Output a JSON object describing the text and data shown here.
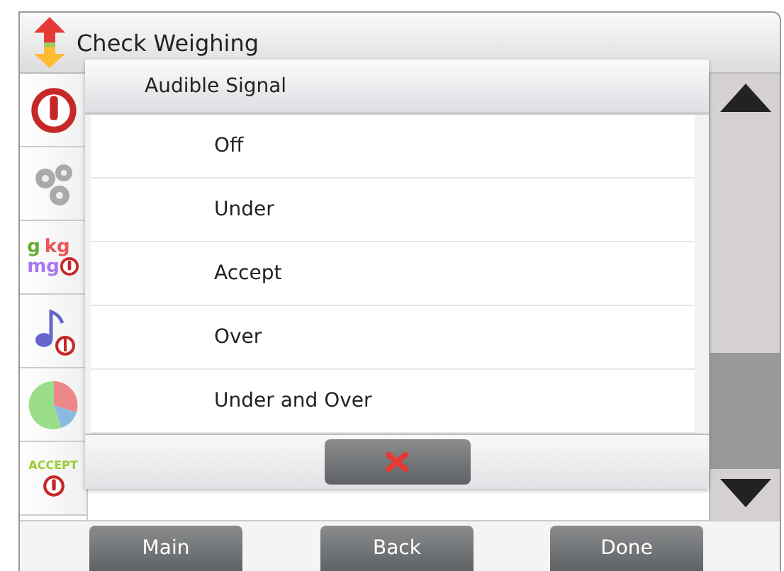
{
  "window": {
    "title": "Check Weighing"
  },
  "sidebar": {
    "items": [
      {
        "kind": "power"
      },
      {
        "kind": "gears"
      },
      {
        "kind": "units",
        "texts": [
          "g",
          "kg",
          "mg"
        ]
      },
      {
        "kind": "music"
      },
      {
        "kind": "pie"
      },
      {
        "kind": "accept",
        "texts": [
          "ACCEPT"
        ]
      }
    ]
  },
  "dialog": {
    "title": "Audible Signal",
    "options": [
      "Off",
      "Under",
      "Accept",
      "Over",
      "Under and Over"
    ]
  },
  "footer": {
    "buttons": [
      "Main",
      "Back",
      "Done"
    ]
  }
}
